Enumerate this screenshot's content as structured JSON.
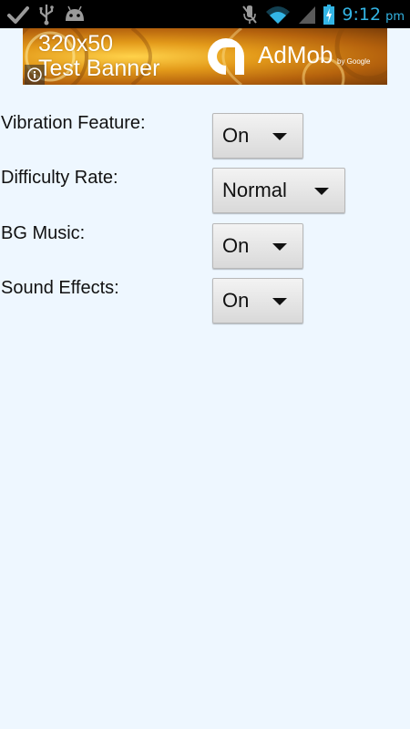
{
  "status_bar": {
    "time": "9:12",
    "ampm": "pm",
    "icons_left": [
      "check-icon",
      "usb-icon",
      "android-icon"
    ],
    "icons_right": [
      "mute-icon",
      "wifi-icon",
      "signal-icon",
      "battery-charging-icon"
    ],
    "clock_color": "#33b5e5"
  },
  "ad": {
    "title_line1": "320x50",
    "title_line2": "Test Banner",
    "brand": "AdMob",
    "by": "by Google"
  },
  "settings": [
    {
      "label": "Vibration Feature:",
      "value": "On"
    },
    {
      "label": "Difficulty Rate:",
      "value": "Normal"
    },
    {
      "label": "BG Music:",
      "value": "On"
    },
    {
      "label": "Sound Effects:",
      "value": "On"
    }
  ],
  "colors": {
    "background": "#eef7ff",
    "status_bar": "#000000"
  }
}
